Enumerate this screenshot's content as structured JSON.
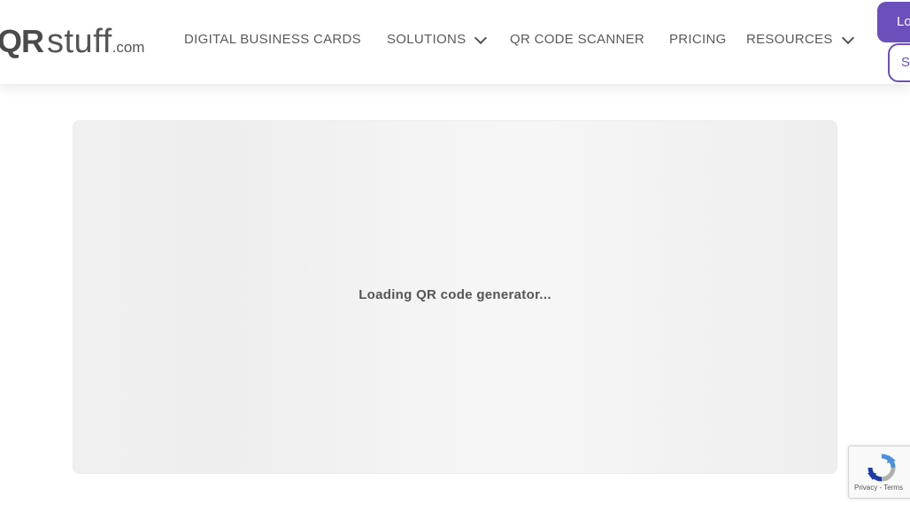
{
  "header": {
    "logo": {
      "qr": "QR",
      "stuff": "stuff",
      "com": ".com"
    },
    "nav": [
      {
        "label": "DIGITAL BUSINESS CARDS",
        "has_dropdown": false
      },
      {
        "label": "SOLUTIONS",
        "has_dropdown": true
      },
      {
        "label": "QR CODE SCANNER",
        "has_dropdown": false
      },
      {
        "label": "PRICING",
        "has_dropdown": false
      },
      {
        "label": "RESOURCES",
        "has_dropdown": true
      }
    ],
    "login_label": "Login",
    "signup_label": "Sign up"
  },
  "main": {
    "loading_text": "Loading QR code generator..."
  },
  "recaptcha": {
    "links": "Privacy - Terms"
  },
  "colors": {
    "accent": "#6b4fbb",
    "nav_text": "#5a5a5a",
    "panel_bg": "#f2f2f2"
  }
}
